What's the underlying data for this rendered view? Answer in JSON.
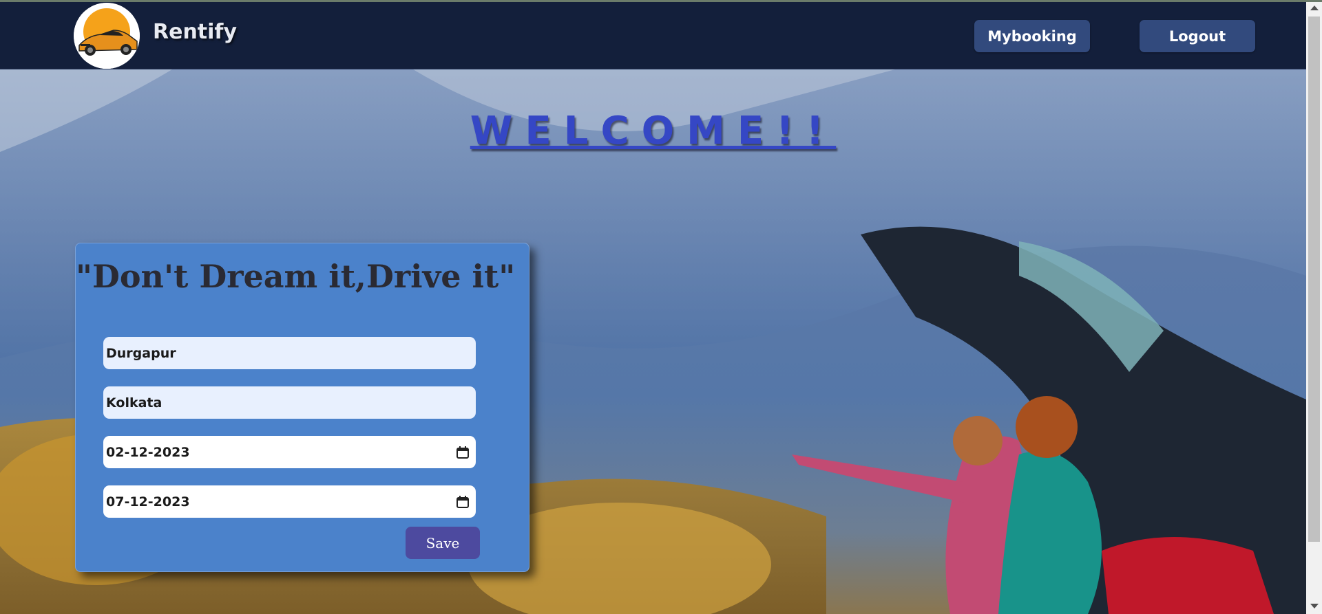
{
  "header": {
    "brand": "Rentify",
    "nav": {
      "mybooking_label": "Mybooking",
      "logout_label": "Logout"
    }
  },
  "hero": {
    "welcome": "WELCOME!!"
  },
  "booking_form": {
    "tagline": "\"Don't Dream it,Drive it\"",
    "from_value": "Durgapur",
    "to_value": "Kolkata",
    "start_date": "02-12-2023",
    "end_date": "07-12-2023",
    "save_label": "Save"
  },
  "icons": {
    "logo": "sports-car-sunset-logo",
    "date_picker": "calendar-icon"
  },
  "colors": {
    "navbar": "#131f3b",
    "nav_button": "#324a7d",
    "welcome": "#3547c5",
    "card": "#4b82cb",
    "save_button": "#4d4a9f"
  }
}
